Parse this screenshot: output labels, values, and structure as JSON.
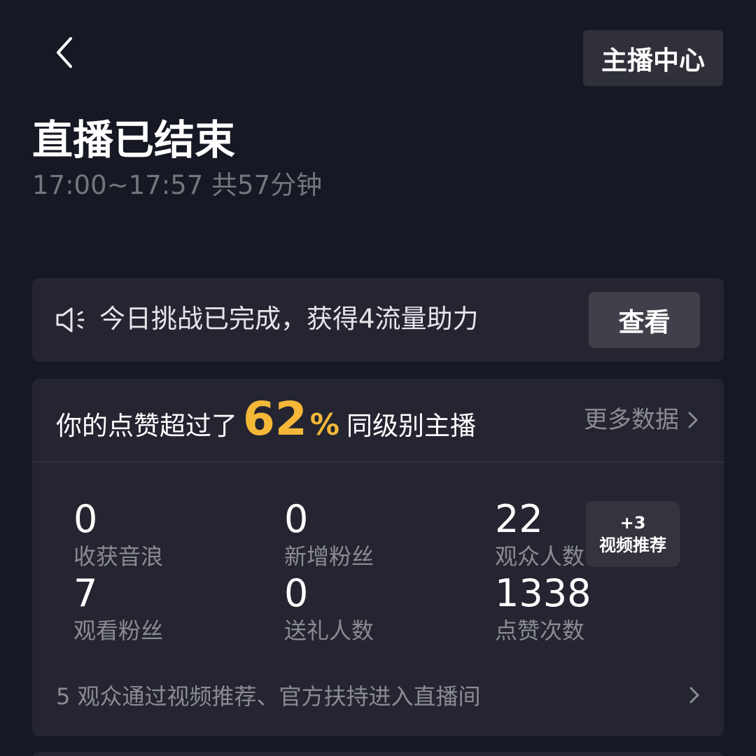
{
  "header": {
    "back_icon": "chevron-left-icon",
    "host_center_label": "主播中心"
  },
  "summary": {
    "title": "直播已结束",
    "time_range": "17:00~17:57",
    "duration": "共57分钟"
  },
  "challenge": {
    "icon": "speaker-icon",
    "text": "今日挑战已完成，获得4流量助力",
    "button_label": "查看"
  },
  "stats": {
    "rank_prefix": "你的点赞超过了",
    "rank_value": "62",
    "rank_percent": "%",
    "rank_suffix": "同级别主播",
    "more_label": "更多数据",
    "items": [
      {
        "value": "0",
        "label": "收获音浪"
      },
      {
        "value": "0",
        "label": "新增粉丝"
      },
      {
        "value": "22",
        "label": "观众人数"
      },
      {
        "value": "7",
        "label": "观看粉丝"
      },
      {
        "value": "0",
        "label": "送礼人数"
      },
      {
        "value": "1338",
        "label": "点赞次数"
      }
    ],
    "tooltip": {
      "value": "+3",
      "label": "视频推荐"
    },
    "footer_count": "5",
    "footer_text": "观众通过视频推荐、官方扶持进入直播间"
  },
  "colors": {
    "background": "#161823",
    "card": "#242530",
    "accent": "#f4b738",
    "muted_text": "#8a8b93"
  }
}
